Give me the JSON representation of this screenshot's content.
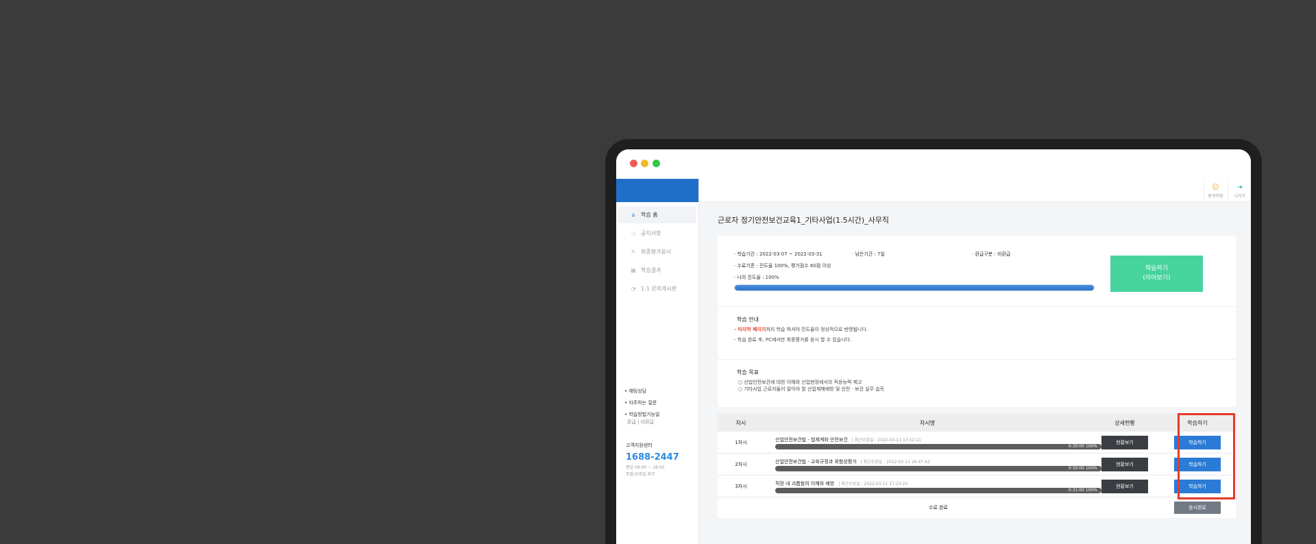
{
  "colors": {
    "accent": "#1f6fc9",
    "study_button": "#47d39d",
    "highlight": "#e53a27",
    "row_button": "#2b7bd6"
  },
  "sidebar": {
    "items": [
      {
        "icon": "home-icon",
        "label": "학습 홈"
      },
      {
        "icon": "megaphone-icon",
        "label": "공지사항"
      },
      {
        "icon": "edit-icon",
        "label": "최종평가응시"
      },
      {
        "icon": "chart-icon",
        "label": "학습결과"
      },
      {
        "icon": "chat-icon",
        "label": "1:1 문의게시판"
      }
    ],
    "links": [
      "• 채팅상담",
      "• 자주하는 질문",
      "• 학습방법가능일"
    ],
    "links_sub": "환급 | 비환급",
    "cs_label": "고객지원센터",
    "cs_phone": "1688-2447",
    "cs_hours_1": "평일 09:00 ~ 18:00",
    "cs_hours_2": "주말/공휴일 휴무"
  },
  "topbar": {
    "remote_label": "원격지원",
    "exit_label": "나가기"
  },
  "page_title": "근로자 정기안전보건교육1_기타사업(1.5시간)_사무직",
  "summary": {
    "period": "· 학습기간  :  2022-03-07 ~ 2022-03-31",
    "remaining": "· 남은기간  :  7일",
    "refund": "· 환급구분  :  비환급",
    "criteria": "· 수료기준  :  진도율 100%, 평가점수 60점 이상",
    "my_progress": "· 나의 진도율  :  100%",
    "progress_value": 100,
    "study_button_line1": "학습하기",
    "study_button_line2": "(이어보기)"
  },
  "guide": {
    "title": "학습 안내",
    "line1_highlight": "- 마지막 페이지",
    "line1_rest": "까지 학습 하셔야 진도율이 정상적으로 반영됩니다.",
    "line2": "- 학습 완료 후, PC에서만 최종평가를 응시 할 수 있습니다."
  },
  "goal": {
    "title": "학습 목표",
    "line1": "○ 산업안전보건에 대한 이해와 산업현장에서의 직응능력 제고",
    "line2": "○ 기타사업 근로자들이 알아야 할 산업재해예방 및 안전 · 보건 실무 습득"
  },
  "table": {
    "headers": [
      "차시",
      "차시명",
      "상세현황",
      "학습하기"
    ],
    "rows": [
      {
        "no": "1차시",
        "title": "산업안전보건법 - 법체계와 안전보건",
        "date": "|  최근수강일 : 2022-03-11 13:52:21",
        "bar": "0:30:00  100%",
        "detail": "현황보기",
        "study": "학습하기",
        "progress": 100
      },
      {
        "no": "2차시",
        "title": "산업안전보건법 - 교육규정과 위험성평가",
        "date": "|  최근수강일 : 2022-03-11 16:47:42",
        "bar": "0:30:00  100%",
        "detail": "현황보기",
        "study": "학습하기",
        "progress": 100
      },
      {
        "no": "3차시",
        "title": "직장 내 괴롭힘의 이해와 예방",
        "date": "|  최근수강일 : 2022-03-11 17:23:20",
        "bar": "0:31:00  100%",
        "detail": "현황보기",
        "study": "학습하기",
        "progress": 100
      }
    ],
    "footer_label": "수료 완료",
    "footer_button": "응시완료"
  }
}
